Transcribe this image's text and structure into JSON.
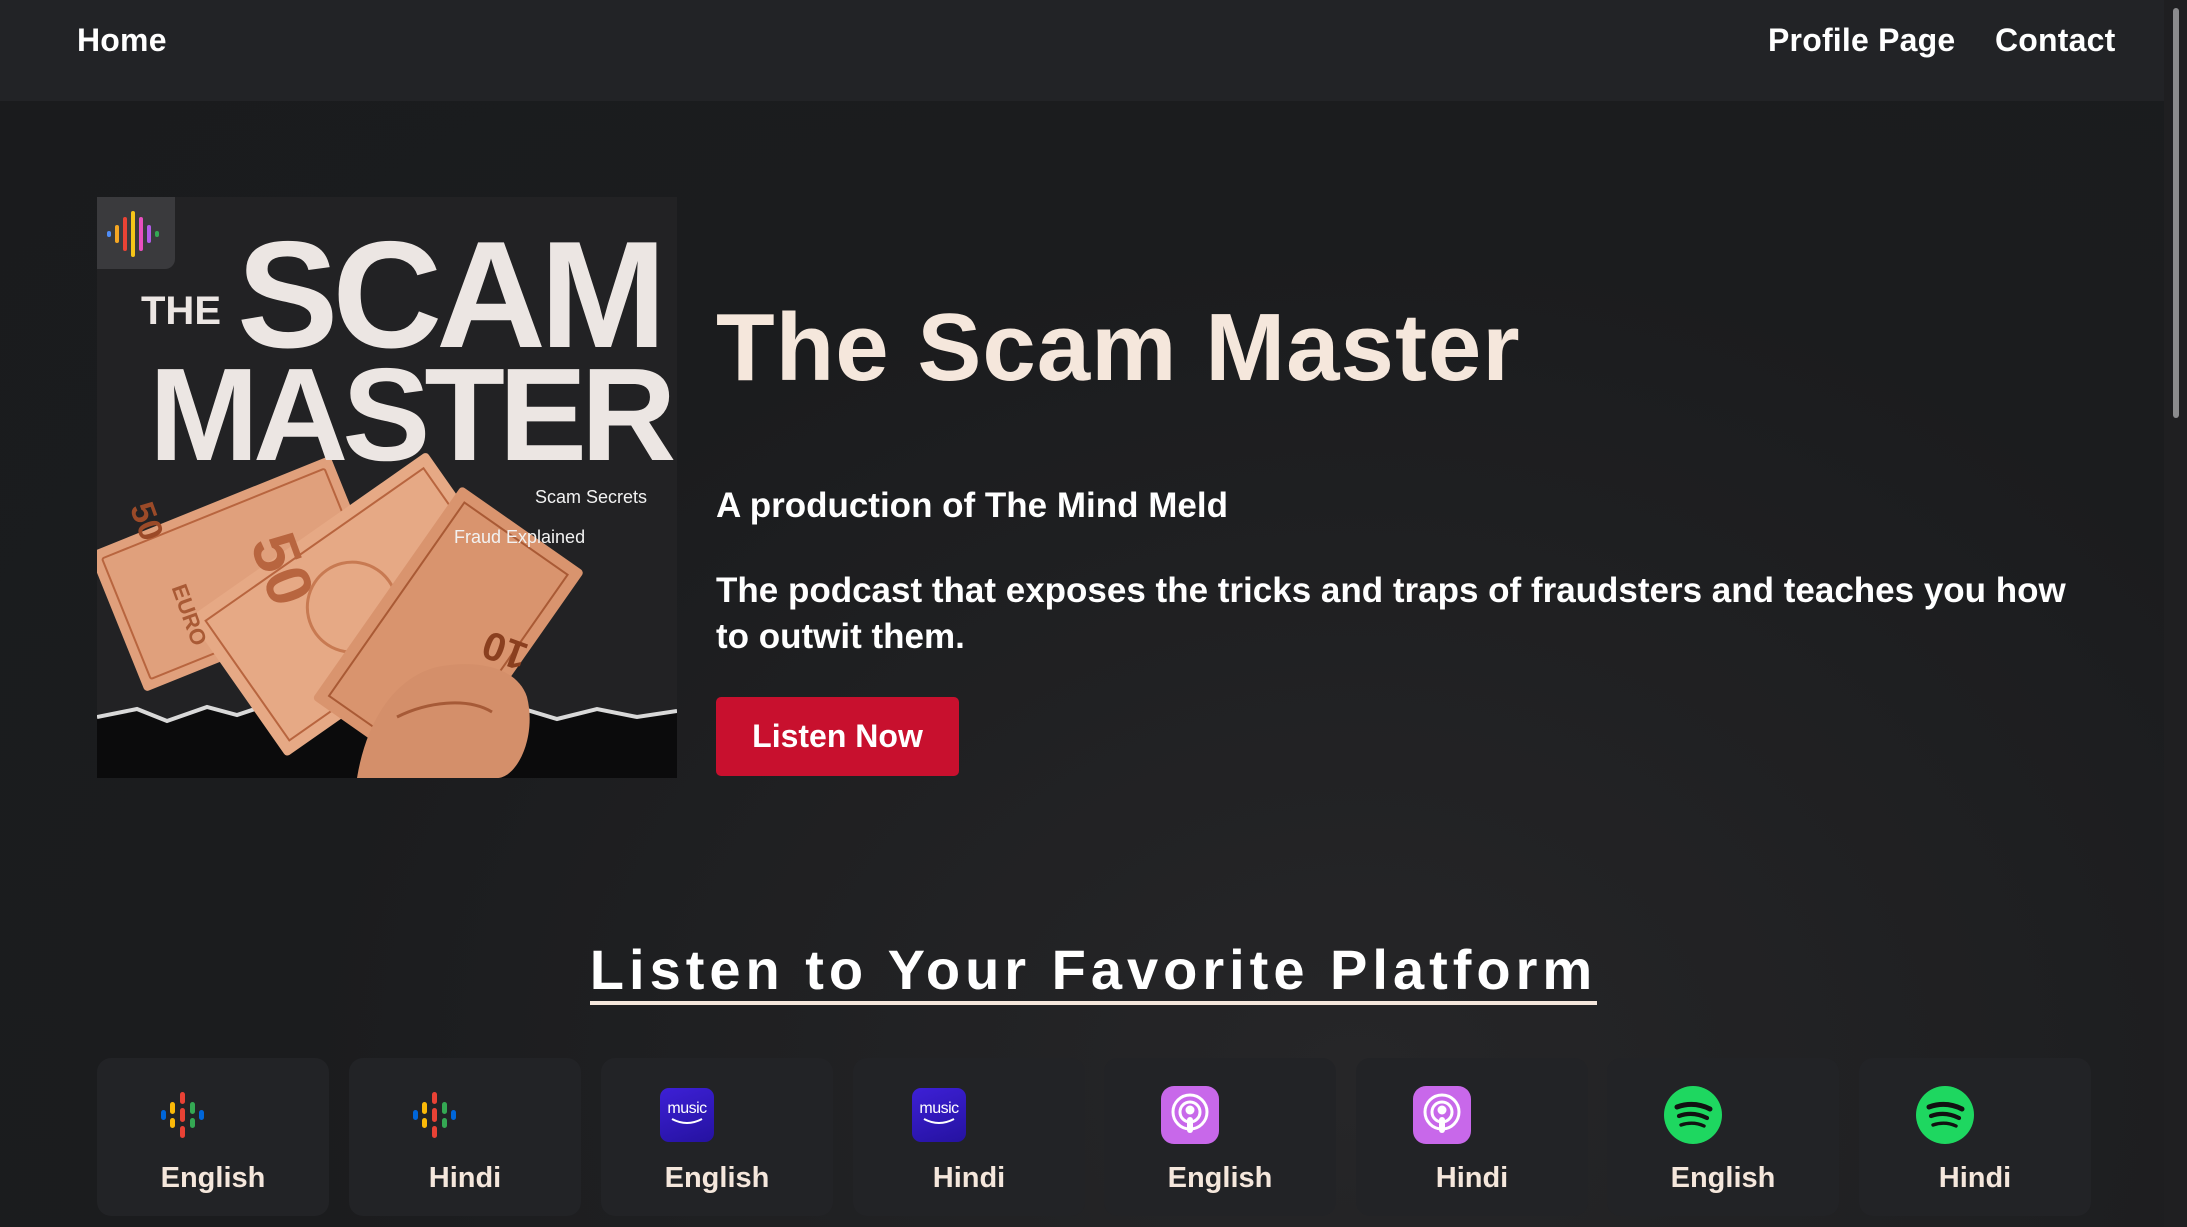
{
  "nav": {
    "home": "Home",
    "profile": "Profile Page",
    "contact": "Contact"
  },
  "cover": {
    "the": "THE",
    "scam": "SCAM",
    "master": "MASTER",
    "tagline1": "Scam Secrets",
    "tagline2": "Fraud Explained",
    "currency_notes": [
      "50",
      "50",
      "10",
      "EURO"
    ]
  },
  "hero": {
    "title": "The Scam Master",
    "subtitle": "A production of The Mind Meld",
    "description": "The podcast that exposes the tricks and traps of fraudsters and teaches you how to outwit them.",
    "cta": "Listen Now"
  },
  "platforms": {
    "title": "Listen to Your Favorite Platform",
    "amazon_label": "music",
    "items": [
      {
        "icon": "google-podcasts-icon",
        "label": "English"
      },
      {
        "icon": "google-podcasts-icon",
        "label": "Hindi"
      },
      {
        "icon": "amazon-music-icon",
        "label": "English"
      },
      {
        "icon": "amazon-music-icon",
        "label": "Hindi"
      },
      {
        "icon": "apple-podcasts-icon",
        "label": "English"
      },
      {
        "icon": "apple-podcasts-icon",
        "label": "Hindi"
      },
      {
        "icon": "spotify-icon",
        "label": "English"
      },
      {
        "icon": "spotify-icon",
        "label": "Hindi"
      }
    ]
  },
  "colors": {
    "accent_red": "#c8102e",
    "title_cream": "#f5e7dc",
    "nav_bg": "#222326",
    "page_bg": "#1b1c1e",
    "spotify_green": "#1ed760",
    "amazon_purple": "#3d20d6"
  }
}
